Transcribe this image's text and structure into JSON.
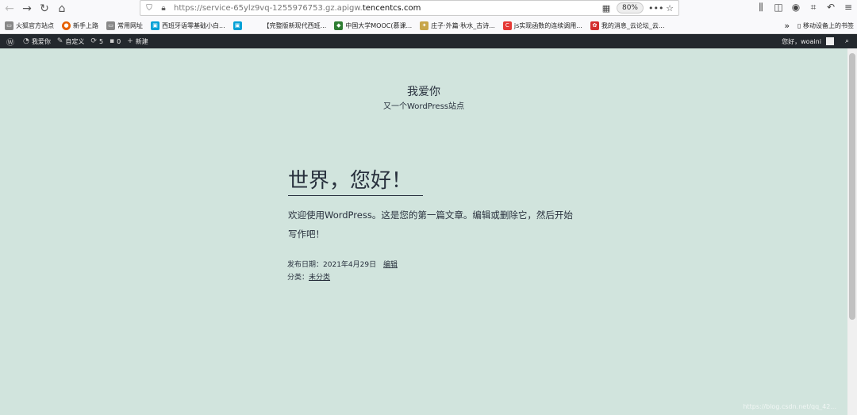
{
  "browser": {
    "url_prefix": "https://service-65ylz9vq-1255976753.gz.apigw.",
    "url_domain": "tencentcs.com",
    "zoom": "80%"
  },
  "bookmarks": {
    "items": [
      {
        "label": "火狐官方站点",
        "color": "#888888"
      },
      {
        "label": "新手上路",
        "color": "#e66000"
      },
      {
        "label": "常用网址",
        "color": "#888888"
      },
      {
        "label": "西班牙语零基础小白...",
        "color": "#00a1d6"
      },
      {
        "label": "",
        "color": "#00a1d6"
      },
      {
        "label": "【完整版新现代西班...",
        "color": "#ffffff"
      },
      {
        "label": "中国大学MOOC(慕课...",
        "color": "#2e7d32"
      },
      {
        "label": "庄子·外篇·秋水_古诗...",
        "color": "#c8a64a"
      },
      {
        "label": "js实现函数的连续调用...",
        "color": "#e53935"
      },
      {
        "label": "我的消息_云论坛_云...",
        "color": "#d32f2f"
      }
    ],
    "more": "»",
    "mobile": "移动设备上的书签"
  },
  "adminbar": {
    "site": "我爱你",
    "customize": "自定义",
    "updates": "5",
    "comments": "0",
    "new": "新建",
    "greeting": "您好，woaini"
  },
  "site": {
    "title": "我爱你",
    "description": "又一个WordPress站点"
  },
  "post": {
    "title": "世界，您好！",
    "body": "欢迎使用WordPress。这是您的第一篇文章。编辑或删除它，然后开始写作吧！",
    "date_label": "发布日期：",
    "date": "2021年4月29日",
    "edit": "编辑",
    "category_label": "分类：",
    "category": "未分类"
  },
  "watermark": "https://blog.csdn.net/qq_42..."
}
